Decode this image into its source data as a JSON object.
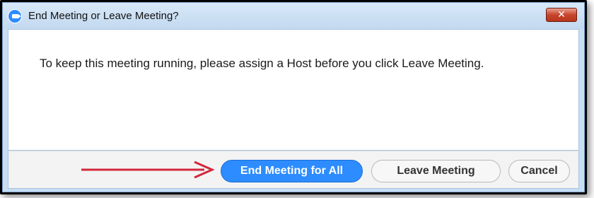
{
  "dialog": {
    "title": "End Meeting or Leave Meeting?",
    "close_glyph": "✕",
    "message": "To keep this meeting running, please assign a Host before you click Leave Meeting."
  },
  "buttons": {
    "end_all": "End Meeting for All",
    "leave": "Leave Meeting",
    "cancel": "Cancel"
  },
  "colors": {
    "accent": "#2d8cff",
    "annotation_arrow": "#d3273a"
  },
  "icons": {
    "app": "zoom-camera-icon",
    "close": "close-icon",
    "annotation": "red-arrow-icon"
  }
}
